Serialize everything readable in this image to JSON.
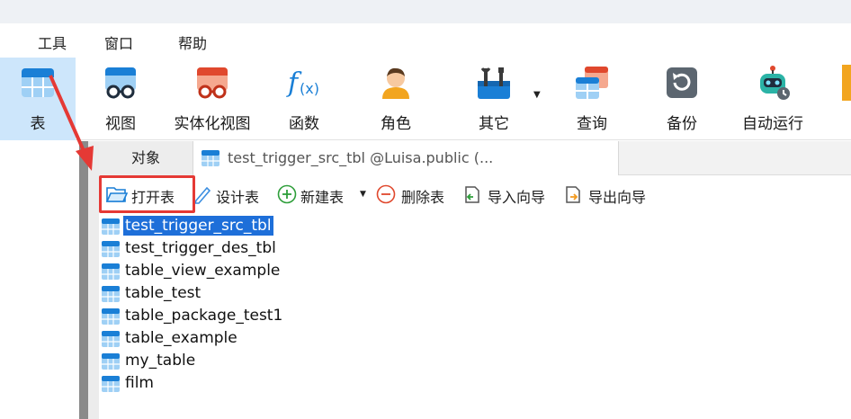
{
  "menu": {
    "items": [
      {
        "label": "工具"
      },
      {
        "label": "窗口"
      },
      {
        "label": "帮助"
      }
    ]
  },
  "toolbar": {
    "buttons": [
      {
        "label": "表",
        "icon": "table-icon",
        "active": true
      },
      {
        "label": "视图",
        "icon": "view-icon"
      },
      {
        "label": "实体化视图",
        "icon": "materialized-view-icon"
      },
      {
        "label": "函数",
        "icon": "function-icon"
      },
      {
        "label": "角色",
        "icon": "user-role-icon"
      },
      {
        "label": "其它",
        "icon": "tools-icon"
      },
      {
        "label": "查询",
        "icon": "query-icon"
      },
      {
        "label": "备份",
        "icon": "backup-icon"
      },
      {
        "label": "自动运行",
        "icon": "robot-icon"
      }
    ]
  },
  "tabs": {
    "objects_label": "对象",
    "document_title": "test_trigger_src_tbl @Luisa.public (..."
  },
  "object_toolbar": {
    "open_table": "打开表",
    "design_table": "设计表",
    "new_table": "新建表",
    "delete_table": "删除表",
    "import_wizard": "导入向导",
    "export_wizard": "导出向导"
  },
  "tables": [
    {
      "name": "test_trigger_src_tbl",
      "selected": true
    },
    {
      "name": "test_trigger_des_tbl"
    },
    {
      "name": "table_view_example"
    },
    {
      "name": "table_test"
    },
    {
      "name": "table_package_test1"
    },
    {
      "name": "table_example"
    },
    {
      "name": "my_table"
    },
    {
      "name": "film"
    }
  ],
  "colors": {
    "selection": "#1e6fd9",
    "active_tool": "#cde6fb",
    "highlight_box": "#e53935",
    "annotation_arrow": "#e53935"
  }
}
